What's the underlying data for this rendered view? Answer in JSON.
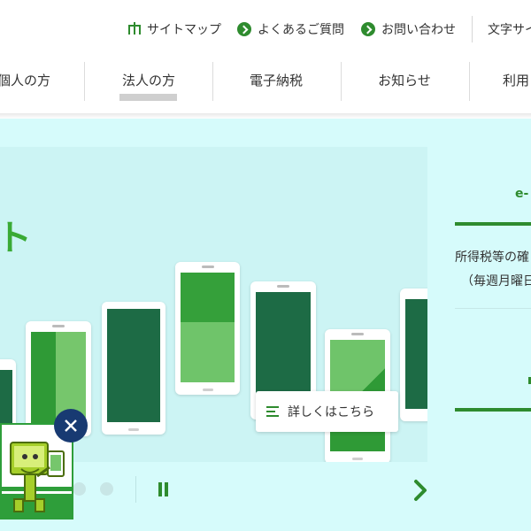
{
  "utility": {
    "sitemap_label": "サイトマップ",
    "faq_label": "よくあるご質問",
    "contact_label": "お問い合わせ",
    "textsize_label": "文字サイ"
  },
  "nav": {
    "items": [
      {
        "label": "個人の方"
      },
      {
        "label": "法人の方"
      },
      {
        "label": "電子納税"
      },
      {
        "label": "お知らせ"
      },
      {
        "label": "利用"
      }
    ],
    "active_index": 1
  },
  "carousel": {
    "headline_fragment": "ト",
    "details_label": "詳しくはこちら"
  },
  "info": {
    "label": "e-",
    "line1": "所得税等の確",
    "line2": "（毎週月曜日"
  },
  "colors": {
    "brand_green": "#2e8b2e",
    "light_green": "#6fc46a",
    "dark_green": "#1d6b45",
    "background_cyan": "#d6fbfb",
    "close_button_navy": "#183a72"
  },
  "icons": [
    "sitemap-icon",
    "arrow-circle-icon",
    "menu-lines-icon",
    "pause-icon",
    "chevron-right-icon",
    "close-icon"
  ]
}
